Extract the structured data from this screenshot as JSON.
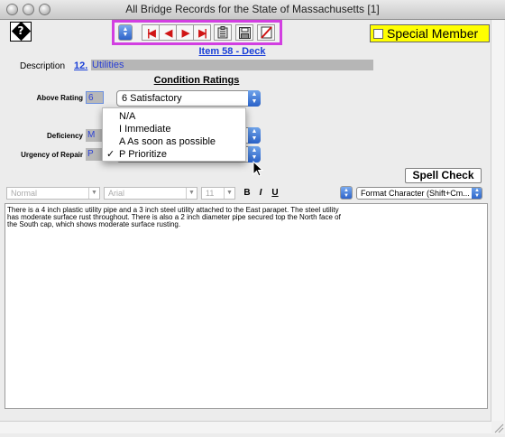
{
  "window": {
    "title": "All Bridge Records for the State of Massachusetts [1]"
  },
  "toolbar": {
    "buttons": [
      "select-popup",
      "first-record",
      "previous-record",
      "next-record",
      "last-record",
      "clipboard",
      "save",
      "delete"
    ]
  },
  "special_member": {
    "label": "Special Member",
    "checked": false,
    "color": "#ffff00"
  },
  "item": {
    "title": "Item 58 - Deck"
  },
  "description": {
    "label": "Description",
    "number": "12.",
    "value": "Utilities"
  },
  "condition": {
    "heading": "Condition Ratings",
    "above_rating": {
      "label": "Above Rating",
      "code": "6",
      "value": "6 Satisfactory"
    },
    "deficiency": {
      "label": "Deficiency",
      "code": "M"
    },
    "urgency": {
      "label": "Urgency of Repair",
      "code": "P"
    }
  },
  "urgency_menu": {
    "items": [
      {
        "label": "N/A",
        "checked": false
      },
      {
        "label": "I Immediate",
        "checked": false
      },
      {
        "label": "A As soon as possible",
        "checked": false
      },
      {
        "label": "P Prioritize",
        "checked": true
      }
    ],
    "check_glyph": "✓"
  },
  "spell_check": {
    "label": "Spell Check"
  },
  "format_bar": {
    "style": "Normal",
    "font": "Arial",
    "size": "11",
    "bold": "B",
    "italic": "I",
    "underline": "U",
    "format_character": "Format Character (Shift+Cm..."
  },
  "notes": {
    "lines": [
      "There is a 4 inch plastic utility pipe and a 3 inch steel utility attached to the East parapet.  The steel utility",
      "has moderate surface rust throughout.  There is also a 2 inch diameter pipe secured top the North face of",
      "the South cap, which shows moderate surface rusting."
    ]
  },
  "colors": {
    "toolbar_border": "#d23fe1",
    "link": "#1a3fd7",
    "nav_red": "#d01414"
  }
}
